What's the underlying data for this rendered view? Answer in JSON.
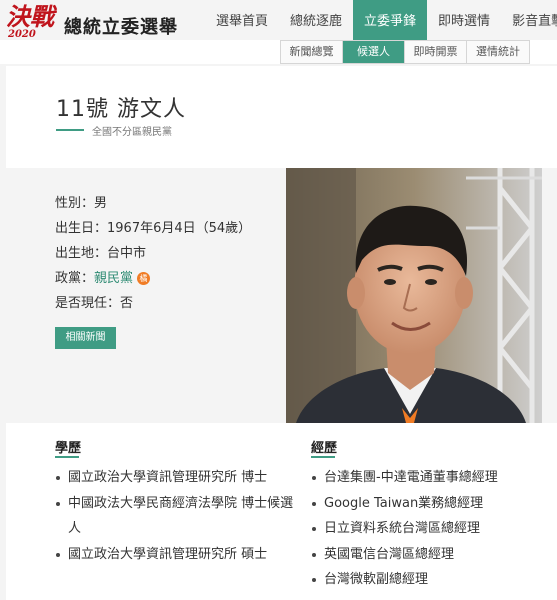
{
  "header": {
    "logo_jue": "決戰",
    "logo_year": "2020",
    "logo_title": "總統立委選舉",
    "nav": [
      {
        "label": "選舉首頁",
        "active": false
      },
      {
        "label": "總統逐鹿",
        "active": false
      },
      {
        "label": "立委爭鋒",
        "active": true
      },
      {
        "label": "即時選情",
        "active": false
      },
      {
        "label": "影音直擊",
        "active": false
      }
    ]
  },
  "subnav": [
    {
      "label": "新聞總覽",
      "active": false
    },
    {
      "label": "候選人",
      "active": true
    },
    {
      "label": "即時開票",
      "active": false
    },
    {
      "label": "選情統計",
      "active": false
    }
  ],
  "candidate": {
    "name": "11號 游文人",
    "subtitle": "全國不分區親民黨"
  },
  "info": {
    "gender": "性別：男",
    "birth": "出生日：1967年6月4日（54歲）",
    "birthplace": "出生地：台中市",
    "party_label": "政黨：",
    "party_name": "親民黨",
    "party_badge": "橘",
    "incumbent": "是否現任：否",
    "news_button": "相關新聞"
  },
  "education": {
    "title": "學歷",
    "items": [
      "國立政治大學資訊管理研究所 博士",
      "中國政法大學民商經濟法學院 博士候選人",
      "國立政治大學資訊管理研究所 碩士"
    ]
  },
  "experience": {
    "title": "經歷",
    "items": [
      "台達集團-中達電通董事總經理",
      "Google Taiwan業務總經理",
      "日立資料系統台灣區總經理",
      "英國電信台灣區總經理",
      "台灣微軟副總經理"
    ]
  },
  "colors": {
    "accent": "#3f9c84",
    "brand_red": "#c0141c",
    "party_orange": "#f07c25"
  }
}
